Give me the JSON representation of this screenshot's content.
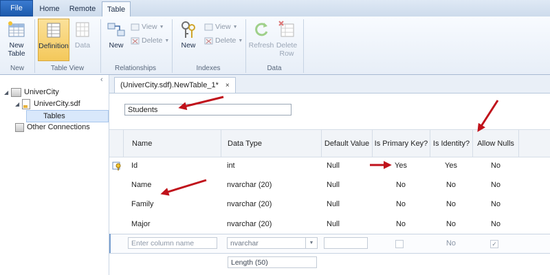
{
  "tabs": {
    "file": "File",
    "home": "Home",
    "remote": "Remote",
    "table": "Table"
  },
  "ribbon": {
    "new_table": "New\nTable",
    "new_table_l1": "New",
    "new_table_l2": "Table",
    "group_new": "New",
    "definition": "Definition",
    "data": "Data",
    "group_table_view": "Table View",
    "rel_new": "New",
    "rel_view": "View",
    "rel_delete": "Delete",
    "group_relationships": "Relationships",
    "idx_new": "New",
    "idx_view": "View",
    "idx_delete": "Delete",
    "group_indexes": "Indexes",
    "refresh": "Refresh",
    "delete_row_l1": "Delete",
    "delete_row_l2": "Row",
    "group_data": "Data"
  },
  "tree": {
    "root": "UniverCity",
    "file": "UniverCity.sdf",
    "tables": "Tables",
    "other": "Other Connections"
  },
  "document": {
    "tab_title": "(UniverCity.sdf).NewTable_1*",
    "close": "×"
  },
  "table_name": "Students",
  "grid": {
    "headers": [
      "Name",
      "Data Type",
      "Default Value",
      "Is Primary Key?",
      "Is Identity?",
      "Allow Nulls"
    ],
    "rows": [
      {
        "name": "Id",
        "type": "int",
        "default": "Null",
        "pk": "Yes",
        "identity": "Yes",
        "nulls": "No"
      },
      {
        "name": "Name",
        "type": "nvarchar (20)",
        "default": "Null",
        "pk": "No",
        "identity": "No",
        "nulls": "No"
      },
      {
        "name": "Family",
        "type": "nvarchar (20)",
        "default": "Null",
        "pk": "No",
        "identity": "No",
        "nulls": "No"
      },
      {
        "name": "Major",
        "type": "nvarchar (20)",
        "default": "Null",
        "pk": "No",
        "identity": "No",
        "nulls": "No"
      }
    ],
    "new_row": {
      "name_placeholder": "Enter column name",
      "type_value": "nvarchar",
      "length_value": "Length (50)",
      "identity": "No",
      "nulls_check": "✓"
    }
  },
  "colors": {
    "annotation_arrow": "#c0121b",
    "selection": "#d9e8fb",
    "active_button": "#f4c85a"
  }
}
